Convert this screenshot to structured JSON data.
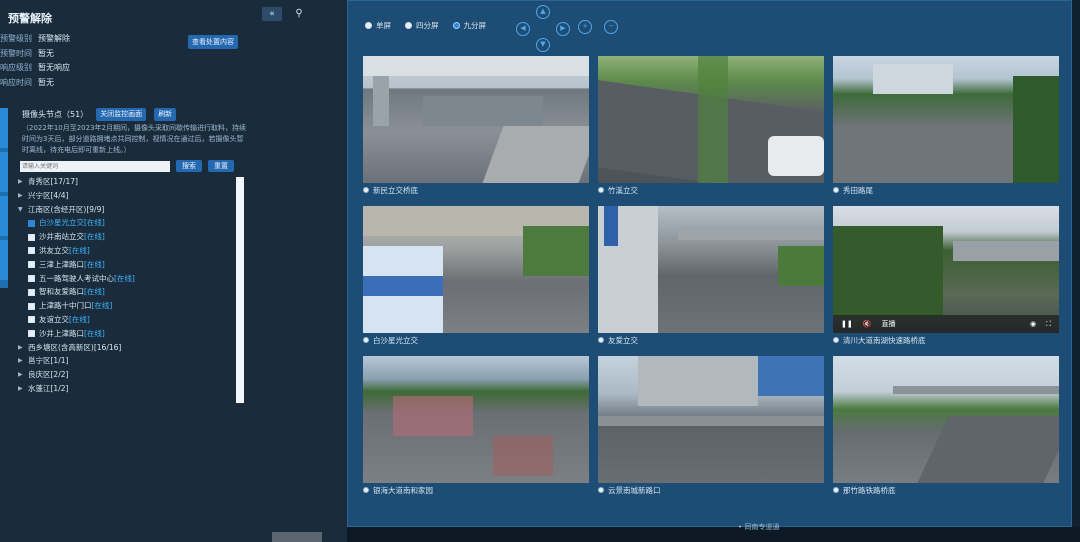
{
  "left_panel": {
    "title": "预警解除",
    "info": [
      {
        "key": "预警级别",
        "value": "预警解除"
      },
      {
        "key": "预警时间",
        "value": "暂无"
      },
      {
        "key": "响应级别",
        "value": "暂无响应"
      },
      {
        "key": "响应时间",
        "value": "暂无"
      }
    ],
    "view_button": "查看处置内容",
    "camera_nodes_label": "摄像头节点（51）",
    "close_button": "关闭监控画面",
    "refresh_button": "刷新",
    "notice": "（2022年10月至2023年2月期间，摄像头采取间歇传输进行取料，持续时间为3天后，部分道路拥堵点共同控制，视情况在通过后，若摄像头暂时离线，待充电后即可重新上线。）",
    "search_placeholder": "请输入关键词",
    "search_button": "搜索",
    "reset_button": "重置",
    "tree": [
      {
        "name": "青秀区[17/17]",
        "type": "group",
        "expanded": false
      },
      {
        "name": "兴宁区[4/4]",
        "type": "group",
        "expanded": false
      },
      {
        "name": "江南区(含经开区)[9/9]",
        "type": "group",
        "expanded": true
      },
      {
        "name": "白沙星光立交",
        "status": "[在线]",
        "type": "item",
        "checked": true,
        "selected": true
      },
      {
        "name": "沙井南站立交",
        "status": "[在线]",
        "type": "item",
        "checked": false
      },
      {
        "name": "洪友立交",
        "status": "[在线]",
        "type": "item",
        "checked": false
      },
      {
        "name": "三津上津路口",
        "status": "[在线]",
        "type": "item",
        "checked": false
      },
      {
        "name": "五一路驾驶人考试中心",
        "status": "[在线]",
        "type": "item",
        "checked": false
      },
      {
        "name": "智和友爱路口",
        "status": "[在线]",
        "type": "item",
        "checked": false
      },
      {
        "name": "上津路十中门口",
        "status": "[在线]",
        "type": "item",
        "checked": false
      },
      {
        "name": "友谊立交",
        "status": "[在线]",
        "type": "item",
        "checked": false
      },
      {
        "name": "沙井上津路口",
        "status": "[在线]",
        "type": "item",
        "checked": false
      },
      {
        "name": "西乡塘区(含高新区)[16/16]",
        "type": "group",
        "expanded": false
      },
      {
        "name": "邕宁区[1/1]",
        "type": "group",
        "expanded": false
      },
      {
        "name": "良庆区[2/2]",
        "type": "group",
        "expanded": false
      },
      {
        "name": "水蓬江[1/2]",
        "type": "group",
        "expanded": false
      }
    ],
    "icons": {
      "collapse": "double-chevron-left-icon",
      "search": "search-icon"
    }
  },
  "view_modes": {
    "options": [
      "单屏",
      "四分屏",
      "九分屏"
    ],
    "selected": "九分屏"
  },
  "ptz_icons": [
    "ptz-up-icon",
    "ptz-left-icon",
    "ptz-right-icon",
    "ptz-down-icon",
    "zoom-in-icon",
    "zoom-out-icon"
  ],
  "cameras": [
    {
      "caption": "新民立交桥底"
    },
    {
      "caption": "竹溪立交"
    },
    {
      "caption": "秀田路尾"
    },
    {
      "caption": "白沙星光立交"
    },
    {
      "caption": "友爱立交"
    },
    {
      "caption": "清川大道南湖快速路桥底"
    },
    {
      "caption": "银海大道南和家园"
    },
    {
      "caption": "云景南城新路口"
    },
    {
      "caption": "那竹路铁路桥底"
    }
  ],
  "player": {
    "live_label": "直播"
  },
  "footer_text": "• 同南专道通"
}
